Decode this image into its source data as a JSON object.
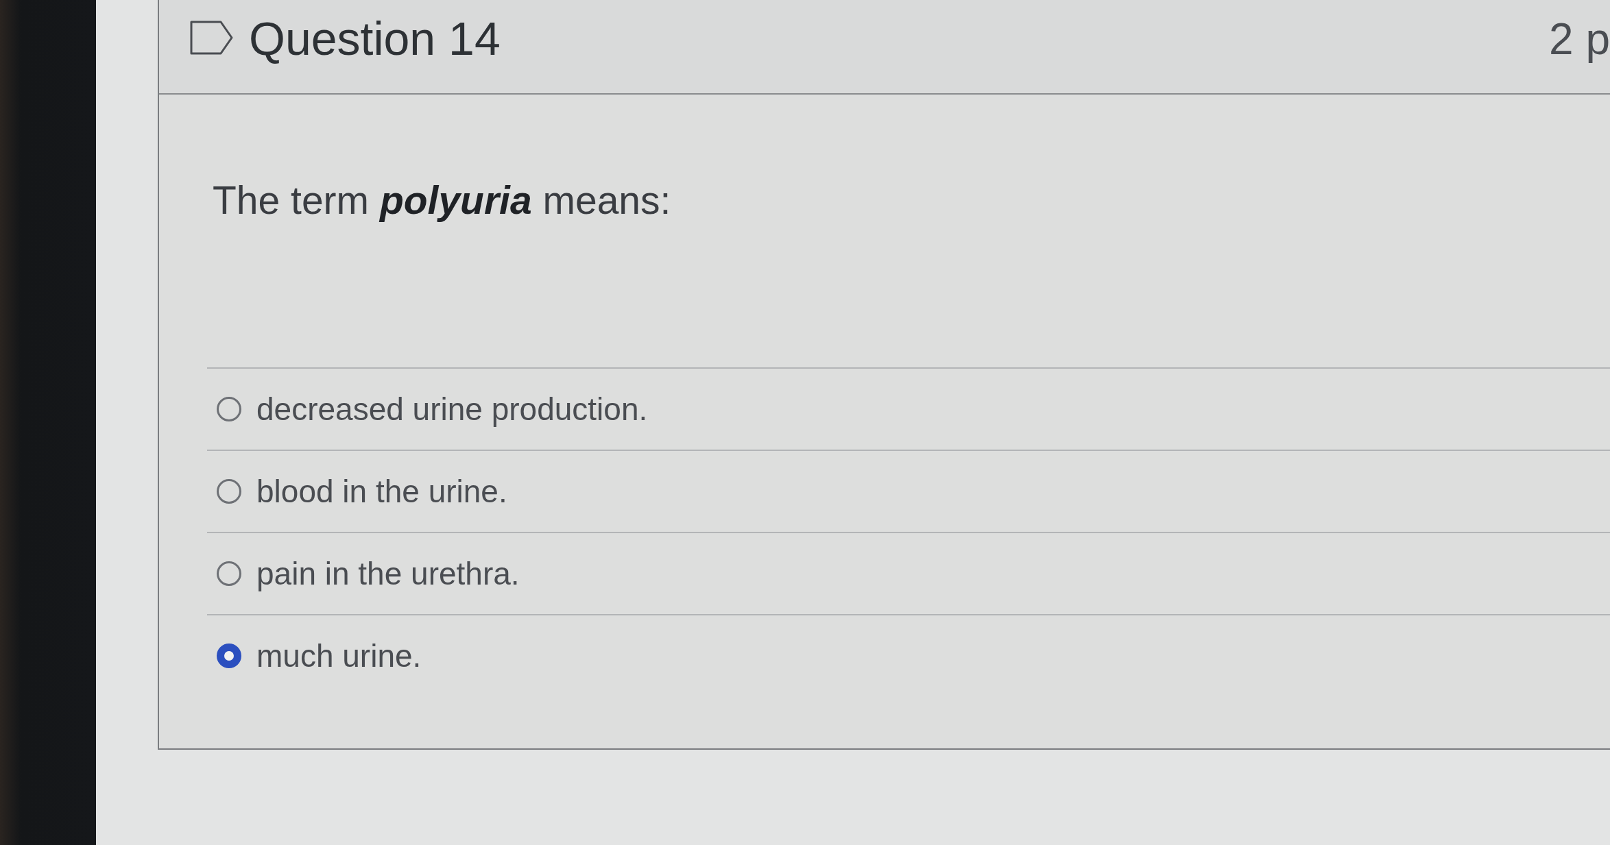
{
  "question": {
    "flagged": false,
    "title": "Question 14",
    "points": "2 p",
    "prompt": "The term **polyuria** means:",
    "answers": [
      {
        "label": "decreased urine production.",
        "selected": false
      },
      {
        "label": "blood in the urine.",
        "selected": false
      },
      {
        "label": "pain in the urethra.",
        "selected": false
      },
      {
        "label": "much urine.",
        "selected": true
      }
    ]
  }
}
